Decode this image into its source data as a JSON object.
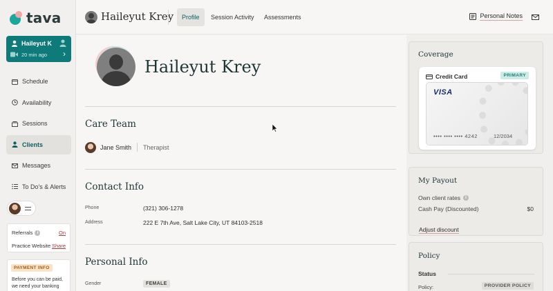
{
  "app": {
    "logo_text": "tava"
  },
  "session_card": {
    "name": "Haileyut K",
    "time": "20 min ago"
  },
  "nav": {
    "items": [
      {
        "label": "Schedule",
        "icon": "calendar-icon"
      },
      {
        "label": "Availability",
        "icon": "clock-icon"
      },
      {
        "label": "Sessions",
        "icon": "stack-icon"
      },
      {
        "label": "Clients",
        "icon": "person-icon",
        "active": true
      },
      {
        "label": "Messages",
        "icon": "mail-icon"
      },
      {
        "label": "To Do's & Alerts",
        "icon": "checklist-icon"
      }
    ]
  },
  "sidebar_links": {
    "referrals_label": "Referrals",
    "referrals_value": "On",
    "website_label": "Practice Website",
    "website_value": "Share"
  },
  "payment_info": {
    "badge": "PAYMENT INFO",
    "text": "Before you can be paid, we need your banking"
  },
  "header": {
    "client_name": "Haileyut Krey",
    "tabs": [
      "Profile",
      "Session Activity",
      "Assessments"
    ],
    "active_tab": "Profile",
    "notes_label": "Personal Notes"
  },
  "profile": {
    "name": "Haileyut Krey",
    "care_team": {
      "title": "Care Team",
      "member_name": "Jane Smith",
      "member_role": "Therapist"
    },
    "contact": {
      "title": "Contact Info",
      "phone_label": "Phone",
      "phone_value": "(321) 306-1278",
      "address_label": "Address",
      "address_value": "222 E 7th Ave, Salt Lake City, UT 84103-2518"
    },
    "personal": {
      "title": "Personal Info",
      "gender_label": "Gender",
      "gender_value": "FEMALE"
    }
  },
  "coverage": {
    "title": "Coverage",
    "card_label": "Credit Card",
    "primary_badge": "PRIMARY",
    "brand": "VISA",
    "number": "•••• •••• •••• 4242",
    "expiry": "12/2034"
  },
  "payout": {
    "title": "My Payout",
    "rates_label": "Own client rates",
    "cash_label": "Cash Pay (Discounted)",
    "cash_value": "$0",
    "adjust_label": "Adjust discount"
  },
  "policy": {
    "title": "Policy",
    "status_label": "Status",
    "policy_label": "Policy:",
    "policy_value": "PROVIDER POLICY"
  },
  "colors": {
    "brand_teal": "#0e7a7a",
    "accent_pink": "#d9a0a0",
    "link_red": "#b23a3a"
  }
}
